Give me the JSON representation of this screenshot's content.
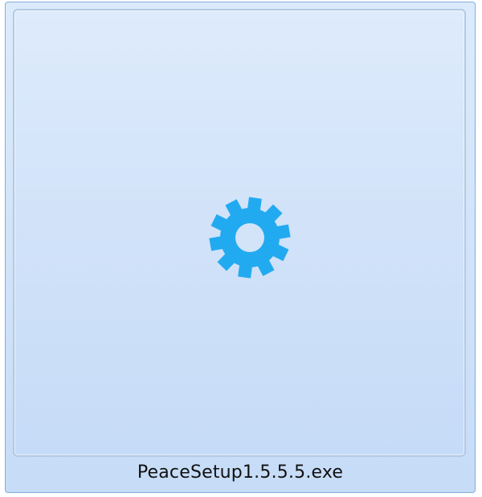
{
  "file": {
    "name": "PeaceSetup1.5.5.5.exe",
    "icon": "gear-icon",
    "icon_color": "#22aaf0"
  },
  "colors": {
    "selection_fill_top": "#dcebfc",
    "selection_fill_bottom": "#c6dcf7",
    "selection_border": "#84acdd",
    "thumbnail_border": "#b4c9e2"
  }
}
